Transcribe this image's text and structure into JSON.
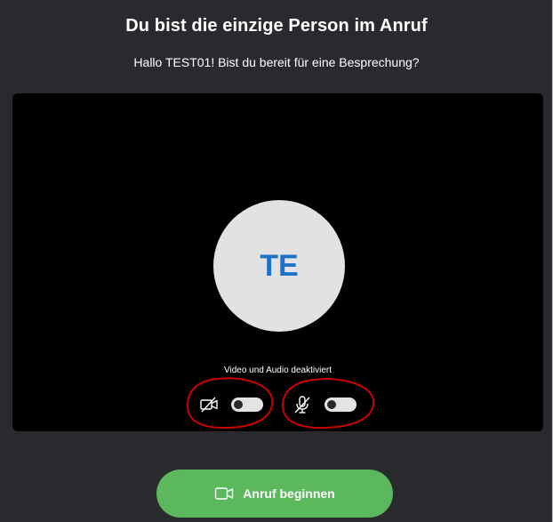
{
  "header": {
    "title": "Du bist die einzige Person im Anruf",
    "subtitle": "Hallo TEST01! Bist du bereit für eine Besprechung?"
  },
  "preview": {
    "avatar_initials": "TE",
    "status_text": "Video und Audio deaktiviert"
  },
  "controls": {
    "camera": {
      "icon": "camera-off-icon",
      "enabled": false
    },
    "microphone": {
      "icon": "microphone-off-icon",
      "enabled": false
    }
  },
  "actions": {
    "start_call_label": "Anruf beginnen",
    "start_call_icon": "video-camera-icon"
  },
  "colors": {
    "background": "#292a2d",
    "video_area": "#000000",
    "avatar_bg": "#e2e2e5",
    "avatar_text": "#1a73c6",
    "button": "#5cb85c",
    "annotation": "#cc0000"
  }
}
